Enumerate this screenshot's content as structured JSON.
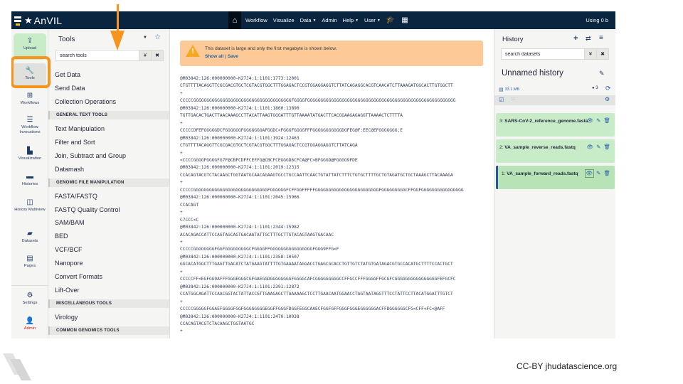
{
  "masthead": {
    "brand": "AnVIL",
    "nav_items": [
      {
        "label": "Workflow",
        "caret": false
      },
      {
        "label": "Visualize",
        "caret": false
      },
      {
        "label": "Data",
        "caret": true
      },
      {
        "label": "Admin",
        "caret": false
      },
      {
        "label": "Help",
        "caret": true
      },
      {
        "label": "User",
        "caret": true
      }
    ],
    "icons": [
      "home-icon",
      "graduation-cap-icon",
      "grid-icon"
    ],
    "usage": "Using 0 b"
  },
  "activity_bar": {
    "items": [
      {
        "id": "upload",
        "label": "Upload",
        "icon": "upload-icon"
      },
      {
        "id": "tools",
        "label": "Tools",
        "icon": "wrench-icon"
      },
      {
        "id": "workflows",
        "label": "Workflows",
        "icon": "sitemap-icon"
      },
      {
        "id": "workflow-invocations",
        "label": "Workflow Invocations",
        "icon": "list-icon"
      },
      {
        "id": "visualization",
        "label": "Visualization",
        "icon": "chart-icon"
      },
      {
        "id": "histories",
        "label": "Histories",
        "icon": "hdd-icon"
      },
      {
        "id": "history-multiview",
        "label": "History Multiview",
        "icon": "columns-icon"
      },
      {
        "id": "datasets",
        "label": "Datasets",
        "icon": "folder-icon"
      },
      {
        "id": "pages",
        "label": "Pages",
        "icon": "file-icon"
      },
      {
        "id": "settings",
        "label": "Settings",
        "icon": "gear-icon"
      },
      {
        "id": "admin",
        "label": "Admin",
        "icon": "user-cog-icon"
      }
    ]
  },
  "tool_panel": {
    "title": "Tools",
    "search_placeholder": "search tools",
    "entries": [
      {
        "type": "item",
        "label": "Get Data"
      },
      {
        "type": "item",
        "label": "Send Data"
      },
      {
        "type": "item",
        "label": "Collection Operations"
      },
      {
        "type": "section",
        "label": "GENERAL TEXT TOOLS"
      },
      {
        "type": "item",
        "label": "Text Manipulation"
      },
      {
        "type": "item",
        "label": "Filter and Sort"
      },
      {
        "type": "item",
        "label": "Join, Subtract and Group"
      },
      {
        "type": "item",
        "label": "Datamash"
      },
      {
        "type": "section",
        "label": "GENOMIC FILE MANIPULATION"
      },
      {
        "type": "item",
        "label": "FASTA/FASTQ"
      },
      {
        "type": "item",
        "label": "FASTQ Quality Control"
      },
      {
        "type": "item",
        "label": "SAM/BAM"
      },
      {
        "type": "item",
        "label": "BED"
      },
      {
        "type": "item",
        "label": "VCF/BCF"
      },
      {
        "type": "item",
        "label": "Nanopore"
      },
      {
        "type": "item",
        "label": "Convert Formats"
      },
      {
        "type": "item",
        "label": "Lift-Over"
      },
      {
        "type": "section",
        "label": "MISCELLANEOUS TOOLS"
      },
      {
        "type": "item",
        "label": "Virology"
      },
      {
        "type": "section",
        "label": "COMMON GENOMICS TOOLS"
      }
    ]
  },
  "center": {
    "alert": {
      "message": "This dataset is large and only the first megabyte is shown below.",
      "show_all": "Show all",
      "separator": "|",
      "save": "Save"
    },
    "fastq_lines": [
      "@M03842:126:000000000-K27J4:1:1101:1773:12001",
      "CTGTTTTACAGGTTCGCGACGTGCTCGTACGTGGCTTTGGAGACTCCGTGGAGGAGGTCTTATCAGAGGCACGTCAACATCTTAAAGATGGCACTTGTGGCTT",
      "+",
      "CCCCCGGGGGGGGGGGGGGGGGGGGGGGGGGGGGGGGGGGGGFGGGGFGGGGGGGGGGGGGGGGGGGGGGGGGGGGGGGGGGGGGGGGGGGGGGGGGGGGGGGG",
      "@M03842:126:000000000-K27J4:1:1101:1860:13890",
      "TGTTGACACTGACTTAACAAAGCCTTACATTAAGTGGGATTTGTTAAAATATGACTTCACGGAAGAGAGGTTAAAACTCTTTTA",
      "+",
      "CCCCCDFEFGGGGGDCFGGGGGGFGGGGGGGAFGGDC<FGGGFGGGGFFFGGGGGGGGGGGDGFEG@F:EEC@EFGGGGGGG,E",
      "@M03842:126:000000000-K27J4:1:1101:1924:12463",
      "CTGTTTTACAGGTTCGCGACGTGCTCGTACGTGGCTTTGGAGACTCCGTGGAGGAGGTCTTATCAGA",
      "+",
      "<CCCCGGGGFGGGGFG7F@CBFCDFFCEFFG@CBCFCEGGGD6CFCA@FC>BFGGGD@FGGGG9FDE",
      "@M03842:126:000000000-K27J4:1:1101:2019:12315",
      "CCACAGTACGTCTACAAGCTGGTAATGCAACAGAAGTGCCTGCCAATTCAACTGTATTATCTTTCTGTGCTTTTGCTGTAGATGCTGCTAAAGCTTACAAAGA",
      "+",
      "CCCCCGGGGGGGGGGGGGGGGGGGGGGGGGGGGFGGGGGGFCFFGGFFFFFGGGGGGGGGGGGGGGGGGGGGGGGFGGGGGGGGGCFFGGFGGGGGGGGGGGGGGGG",
      "@M03842:126:000000000-K27J4:1:1101:2045:15966",
      "CCACAGT",
      "+",
      "C7CCC<C",
      "@M03842:126:000000000-K27J4:1:1101:2344:15982",
      "ACACAGACCATTCCAGTAGCAGTGACAATATTGCTTTGCTTGTACAGTAAGTGACAAC",
      "+",
      "CCCCCGGGGGGGGFGGFGGGGGGGGGCFGGGGFFGGGGGGGGGGGGGGGGFGGG9FFG<F",
      "@M03842:126:000000000-K27J4:1:1101:2358:10507",
      "GGCACATGGCTTTGAGTTGACATCTATGAAGTATTTTGTGAAAATAGGACCTGAGCGCACCTGTTGTCTATGTGATAGACGTGCCACATGCTTTTCCACTGCT",
      "+",
      "CCCCCFF<EGFGG9AFFFGGGEGGGCGFGAEGGDGGGGGGGGFGGGGCAFCGGGGGGGGGCCFFGCCFFFGGGGFFGCGFCGGGGGGGGGGGGGGGGFEFGCFC",
      "@M03842:126:000000000-K27J4:1:1101:2391:12872",
      "CCATGGCAGATTCCAACGGTACTATTACCGTTGAAGAGCTTAAAAAGCTCCTTGAACAATGGAACCTAGTAATAGGTTTCCTATTCCTTACATGGATTTGTCT",
      "+",
      "CCCCCGGGGGFGGAEFGGGGFGGFGGGGGGGGEGGFFGGGFDGGFEGGCAAECFGGFGFFGGGFGGGEGGGGGGACFFDGGGGGGCFG<CFF<FC<@AFF",
      "@M03842:126:000000000-K27J4:1:1101:2470:10938",
      "CCACAGTACGTCTACAAGCTGGTAATGC",
      "+"
    ]
  },
  "history": {
    "title": "History",
    "search_placeholder": "search datasets",
    "name": "Unnamed history",
    "size": "33.1 MB",
    "count": "3",
    "datasets": [
      {
        "hid": "3:",
        "name": "SARS-CoV-2_reference_genome.fasta",
        "active": false
      },
      {
        "hid": "2:",
        "name": "VA_sample_reverse_reads.fastq",
        "active": false
      },
      {
        "hid": "1:",
        "name": "VA_sample_forward_reads.fastq",
        "active": true
      }
    ]
  },
  "footer": {
    "license": "CC-BY jhudatascience.org"
  },
  "colors": {
    "masthead": "#0a2540",
    "highlight": "#f6941e",
    "upload_bg": "#c8ecc8",
    "dataset_ok": "#c8ecc8",
    "alert_bg": "#fcc997",
    "link": "#2265a2",
    "admin": "#d81b1b"
  }
}
